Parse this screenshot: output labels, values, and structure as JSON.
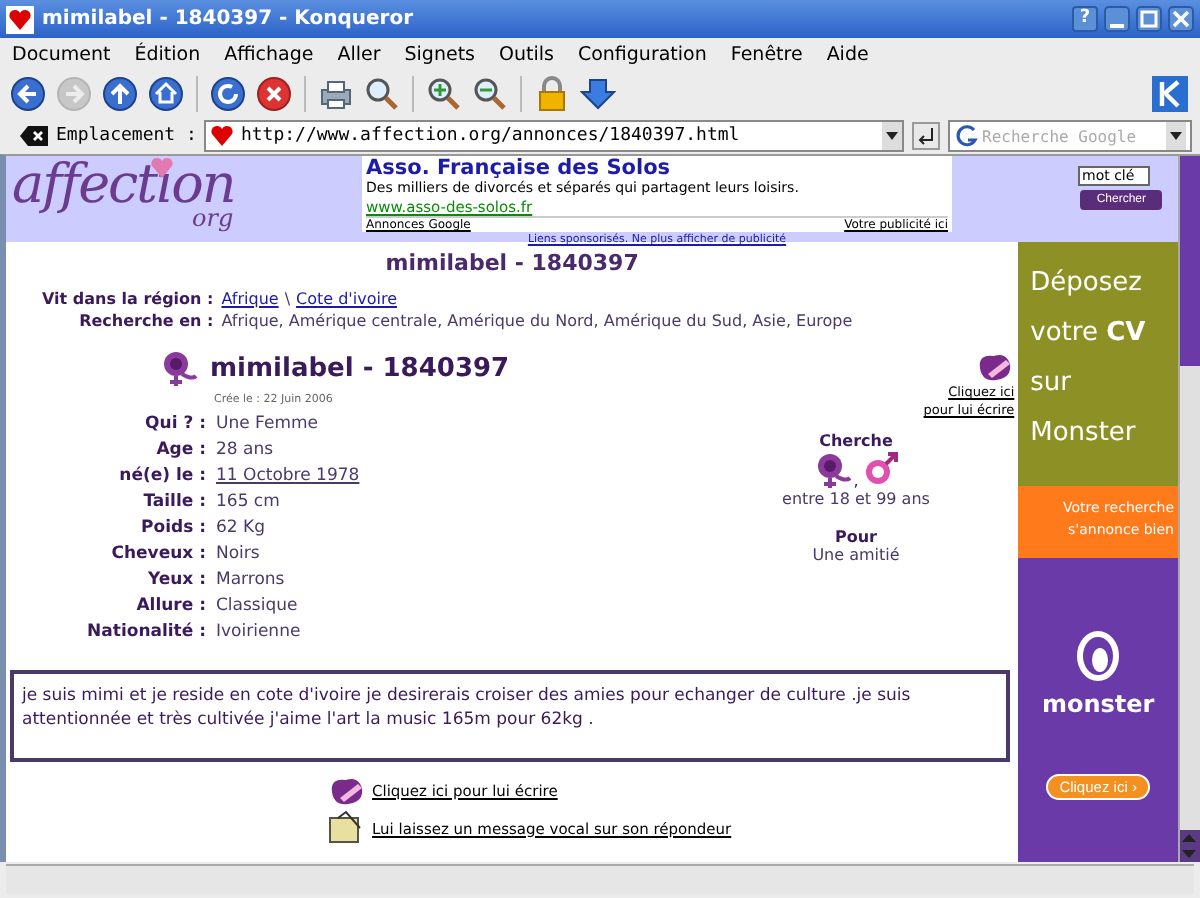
{
  "window": {
    "title": "mimilabel - 1840397 - Konqueror",
    "help_button": "?"
  },
  "menu": [
    "Document",
    "Édition",
    "Affichage",
    "Aller",
    "Signets",
    "Outils",
    "Configuration",
    "Fenêtre",
    "Aide"
  ],
  "toolbar": [
    {
      "kind": "back",
      "disabled": false
    },
    {
      "kind": "forward",
      "disabled": true
    },
    {
      "kind": "up",
      "disabled": false
    },
    {
      "kind": "home",
      "disabled": false
    },
    {
      "kind": "reload",
      "disabled": false
    },
    {
      "kind": "stop",
      "disabled": false
    },
    {
      "kind": "print",
      "disabled": false
    },
    {
      "kind": "magnify",
      "disabled": false
    },
    {
      "kind": "zoom-in",
      "disabled": false
    },
    {
      "kind": "zoom-out",
      "disabled": false
    },
    {
      "kind": "lock",
      "disabled": false
    },
    {
      "kind": "download",
      "disabled": false
    }
  ],
  "location": {
    "label": "Emplacement :",
    "url": "http://www.affection.org/annonces/1840397.html",
    "search_placeholder": "Recherche Google"
  },
  "header": {
    "logo": "affection",
    "logo_sub": "org",
    "ad": {
      "title": "Asso. Française des Solos",
      "text": "Des milliers de divorcés et séparés qui partagent leurs loisirs.",
      "link": "www.asso-des-solos.fr",
      "source": "Annonces Google",
      "own_ad": "Votre publicité ici"
    },
    "sponsored": "Liens sponsorisés. Ne plus afficher de publicité",
    "search": {
      "value": "mot clé",
      "button": "Chercher"
    }
  },
  "page_title": "mimilabel - 1840397",
  "region": {
    "label": "Vit dans la région :",
    "links": [
      "Afrique",
      "Cote d'ivoire"
    ],
    "separator": "\\"
  },
  "search_in": {
    "label": "Recherche en :",
    "value": "Afrique, Amérique centrale, Amérique du Nord, Amérique du Sud, Asie, Europe"
  },
  "profile": {
    "name": "mimilabel - 1840397",
    "created": "Crée le : 22 Juin 2006",
    "write": [
      "Cliquez ici",
      "pour lui écrire"
    ],
    "fields": [
      {
        "label": "Qui ? :",
        "value": "Une Femme",
        "kind": "text"
      },
      {
        "label": "Age :",
        "value": "28 ans",
        "kind": "text"
      },
      {
        "label": "né(e) le :",
        "value": "11 Octobre 1978",
        "kind": "link"
      },
      {
        "label": "Taille :",
        "value": "165 cm",
        "kind": "text"
      },
      {
        "label": "Poids :",
        "value": "62 Kg",
        "kind": "text"
      },
      {
        "label": "Cheveux :",
        "value": "Noirs",
        "kind": "text"
      },
      {
        "label": "Yeux :",
        "value": "Marrons",
        "kind": "text"
      },
      {
        "label": "Allure :",
        "value": "Classique",
        "kind": "text"
      },
      {
        "label": "Nationalité :",
        "value": "Ivoirienne",
        "kind": "text"
      }
    ],
    "seeks": {
      "title": "Cherche",
      "separator": ",",
      "ages": "entre 18 et 99 ans",
      "for_title": "Pour",
      "for_value": "Une amitié"
    }
  },
  "description": "je suis mimi et je reside en cote d'ivoire je desirerais croiser des amies pour echanger de culture .je suis attentionnée et très cultivée j'aime l'art la music 165m pour 62kg .",
  "actions": [
    "Cliquez ici pour lui écrire",
    "Lui laissez un message vocal sur son répondeur"
  ],
  "banner": {
    "lines": [
      "Déposez",
      "votre **CV**",
      "sur",
      "Monster"
    ],
    "tagline": "Votre recherche s'annonce bien",
    "brand": "monster",
    "button": "Cliquez ici ›"
  }
}
